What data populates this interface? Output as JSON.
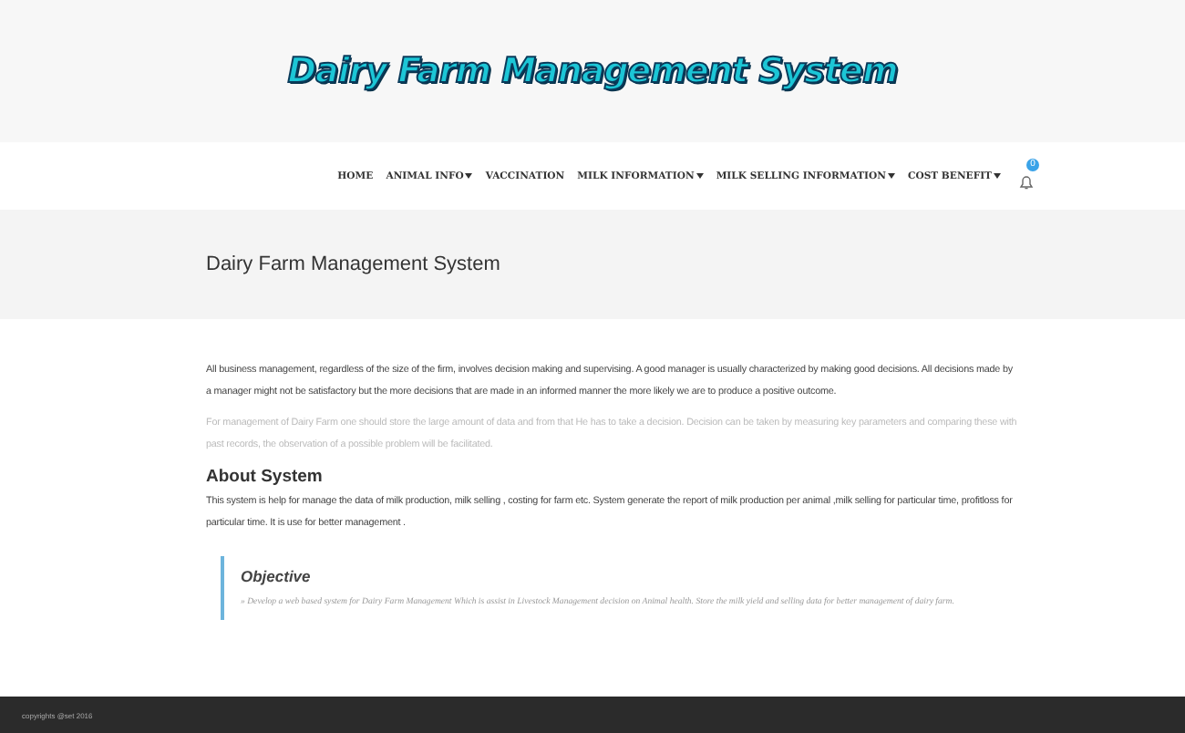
{
  "logo": "Dairy Farm Management System",
  "nav": [
    {
      "label": "HOME",
      "dropdown": false
    },
    {
      "label": "ANIMAL INFO",
      "dropdown": true
    },
    {
      "label": "VACCINATION",
      "dropdown": false
    },
    {
      "label": "MILK INFORMATION",
      "dropdown": true
    },
    {
      "label": "MILK SELLING INFORMATION",
      "dropdown": true
    },
    {
      "label": "COST BENEFIT",
      "dropdown": true
    }
  ],
  "notifications": {
    "count": "0"
  },
  "page_title": "Dairy Farm Management System",
  "intro": "All business management, regardless of the size of the firm, involves decision making and supervising. A good manager is usually characterized by making good decisions. All decisions made by a manager might not be satisfactory but the more decisions that are made in an informed manner the more likely we are to produce a positive outcome.",
  "intro_faded": "For management of Dairy Farm one should store the large amount of data and from that He has to take a decision. Decision can be taken by measuring key parameters and comparing these with past records, the observation of a possible problem will be facilitated.",
  "about": {
    "heading": "About System",
    "text": "This system is help for manage the data of milk production, milk selling , costing for farm etc. System generate the report of milk production per animal ,milk selling for particular time, profitloss for particular time. It is use for better management ."
  },
  "objective": {
    "heading": "Objective",
    "text": "» Develop a web based system for Dairy Farm Management Which is assist in Livestock Management decision on Animal health. Store the milk yield and selling data for better management of dairy farm."
  },
  "footer": "copyrights @set 2016"
}
